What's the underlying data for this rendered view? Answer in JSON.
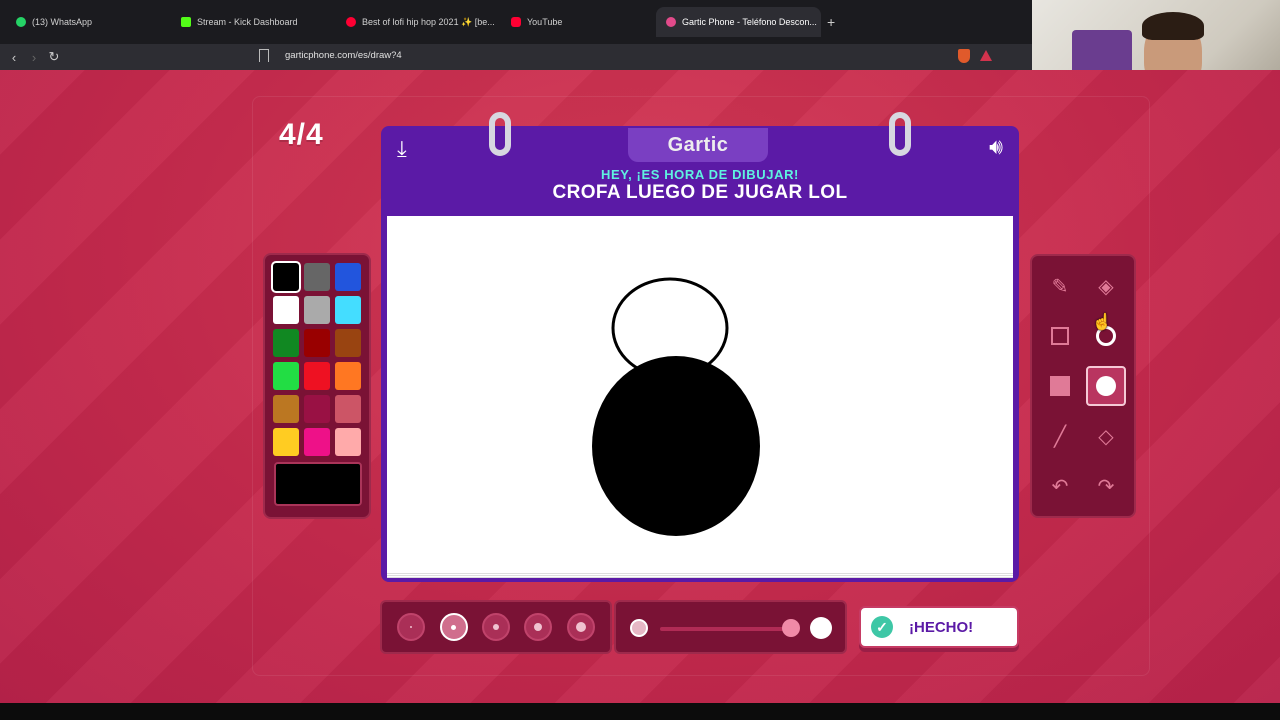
{
  "browser": {
    "tabs": [
      {
        "label": "(13) WhatsApp",
        "color": "#25d366"
      },
      {
        "label": "Stream - Kick Dashboard",
        "color": "#53fc18"
      },
      {
        "label": "Best of lofi hip hop 2021 ✨ [be...",
        "color": "#ff0033"
      },
      {
        "label": "YouTube",
        "color": "#ff0033"
      },
      {
        "label": "Gartic Phone - Teléfono Descon...",
        "color": "#e24a8a"
      }
    ],
    "new_tab": "+",
    "url": "garticphone.com/es/draw?4"
  },
  "game": {
    "round": "4/4",
    "logo": "Gartic",
    "prompt_header": "HEY, ¡ES HORA DE DIBUJAR!",
    "theme": "CROFA LUEGO DE JUGAR LOL",
    "done_label": "¡HECHO!"
  },
  "palette": {
    "colors": [
      "#000000",
      "#666666",
      "#2255dd",
      "#ffffff",
      "#aaaaaa",
      "#44ddff",
      "#118822",
      "#990000",
      "#994411",
      "#22dd44",
      "#ee1122",
      "#ff7722",
      "#bb7722",
      "#991144",
      "#cc5566",
      "#ffcc22",
      "#ee1188",
      "#ffaaaa"
    ],
    "selected_index": 0,
    "current_color": "#000000"
  },
  "tools": [
    {
      "name": "pencil-icon",
      "glyph": "✎"
    },
    {
      "name": "eraser-icon",
      "glyph": "◈"
    },
    {
      "name": "rectangle-outline-icon",
      "glyph": ""
    },
    {
      "name": "ellipse-outline-icon",
      "glyph": ""
    },
    {
      "name": "rectangle-filled-icon",
      "glyph": ""
    },
    {
      "name": "ellipse-filled-icon",
      "glyph": ""
    },
    {
      "name": "line-icon",
      "glyph": "╱"
    },
    {
      "name": "fill-bucket-icon",
      "glyph": "◇"
    },
    {
      "name": "undo-icon",
      "glyph": "↶"
    },
    {
      "name": "redo-icon",
      "glyph": "↷"
    }
  ],
  "active_tool": "ellipse-filled-icon",
  "brush_sizes_selected": 1,
  "opacity_level": 0.95
}
